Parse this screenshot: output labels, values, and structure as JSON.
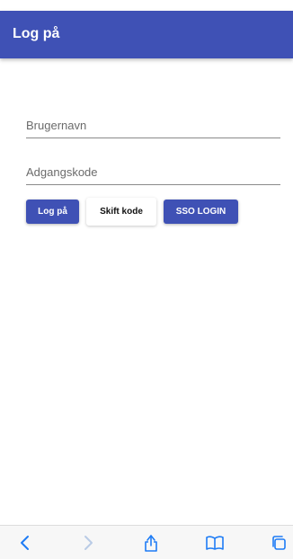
{
  "app_bar": {
    "title": "Log på"
  },
  "form": {
    "username": {
      "placeholder": "Brugernavn",
      "value": ""
    },
    "password": {
      "placeholder": "Adgangskode",
      "value": ""
    }
  },
  "buttons": {
    "login": "Log på",
    "change_code": "Skift kode",
    "sso": "SSO LOGIN"
  },
  "colors": {
    "primary": "#3f51b5",
    "browser_icon": "#1e7cf5",
    "browser_icon_disabled": "#b9cbe6"
  },
  "browser_toolbar": {
    "icons": [
      "chevron-left-icon",
      "chevron-right-icon",
      "share-icon",
      "bookmarks-icon",
      "tabs-icon"
    ]
  }
}
